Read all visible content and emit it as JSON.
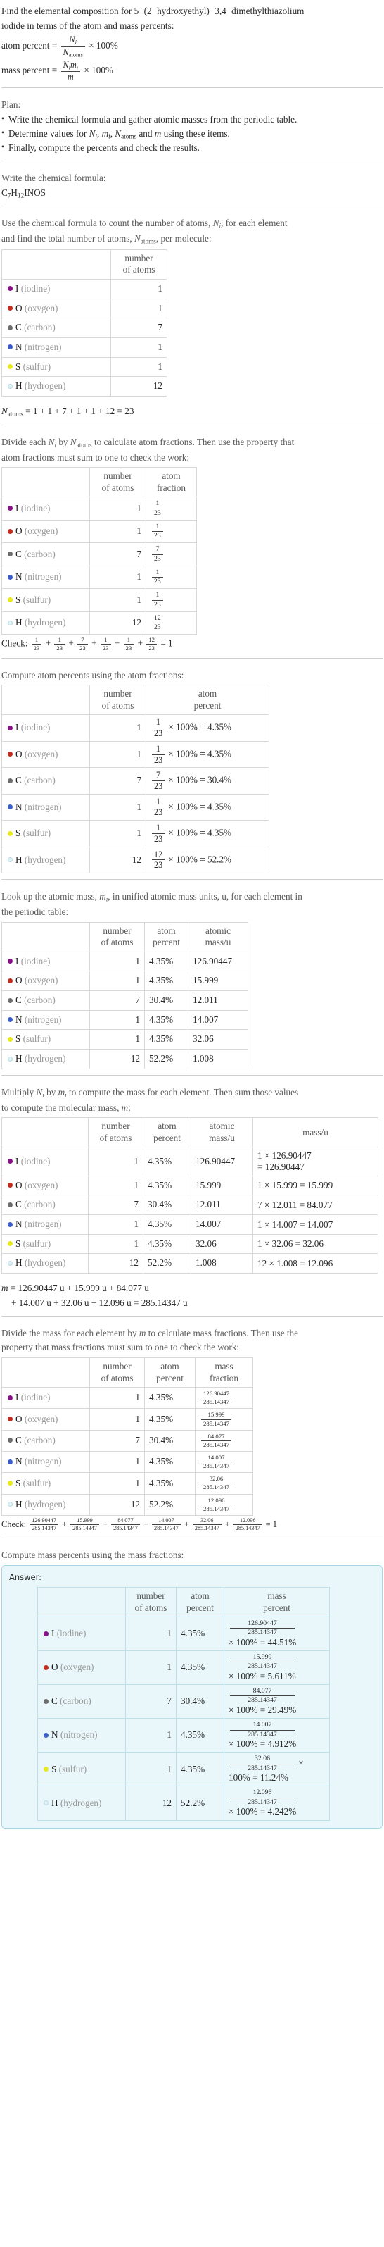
{
  "problem": {
    "statement_line1": "Find the elemental composition for 5−(2−hydroxyethyl)−3,4−dimethylthiazolium",
    "statement_line2": "iodide in terms of the atom and mass percents:",
    "atom_percent_label": "atom percent",
    "mass_percent_label": "mass percent",
    "times_100": "× 100%"
  },
  "plan": {
    "title": "Plan:",
    "items": [
      "Write the chemical formula and gather atomic masses from the periodic table.",
      "Determine values for Nᵢ, mᵢ, Nₐₜₒₘₛ and m using these items.",
      "Finally, compute the percents and check the results."
    ]
  },
  "formula_section": {
    "prompt": "Write the chemical formula:",
    "formula": "C7H12INOS",
    "formula_parts": [
      {
        "sym": "C",
        "sub": "7"
      },
      {
        "sym": "H",
        "sub": "12"
      },
      {
        "sym": "I",
        "sub": ""
      },
      {
        "sym": "N",
        "sub": ""
      },
      {
        "sym": "O",
        "sub": ""
      },
      {
        "sym": "S",
        "sub": ""
      }
    ]
  },
  "colors": {
    "iodine": "#8a0f8a",
    "oxygen": "#c32b1c",
    "carbon": "#6e6e6e",
    "nitrogen": "#3a5fcd",
    "sulfur": "#e8e81a",
    "hydrogen": "#dff2f7",
    "answer_bg": "#e9f7fb",
    "answer_border": "#a9d6e5"
  },
  "elements": [
    {
      "symbol": "I",
      "name": "(iodine)",
      "color": "#8a0f8a",
      "count": "1",
      "fraction_num": "1",
      "atom_percent": "4.35%",
      "atomic_mass": "126.90447",
      "mass_expr": "1 × 126.90447",
      "mass_expr_tail": "= 126.90447",
      "mass_value": "126.90447",
      "mass_percent": "44.51%"
    },
    {
      "symbol": "O",
      "name": "(oxygen)",
      "color": "#c32b1c",
      "count": "1",
      "fraction_num": "1",
      "atom_percent": "4.35%",
      "atomic_mass": "15.999",
      "mass_expr": "1 × 15.999 = 15.999",
      "mass_expr_tail": "",
      "mass_value": "15.999",
      "mass_percent": "5.611%"
    },
    {
      "symbol": "C",
      "name": "(carbon)",
      "color": "#6e6e6e",
      "count": "7",
      "fraction_num": "7",
      "atom_percent": "30.4%",
      "atomic_mass": "12.011",
      "mass_expr": "7 × 12.011 = 84.077",
      "mass_expr_tail": "",
      "mass_value": "84.077",
      "mass_percent": "29.49%"
    },
    {
      "symbol": "N",
      "name": "(nitrogen)",
      "color": "#3a5fcd",
      "count": "1",
      "fraction_num": "1",
      "atom_percent": "4.35%",
      "atomic_mass": "14.007",
      "mass_expr": "1 × 14.007 = 14.007",
      "mass_expr_tail": "",
      "mass_value": "14.007",
      "mass_percent": "4.912%"
    },
    {
      "symbol": "S",
      "name": "(sulfur)",
      "color": "#e8e81a",
      "count": "1",
      "fraction_num": "1",
      "atom_percent": "4.35%",
      "atomic_mass": "32.06",
      "mass_expr": "1 × 32.06 = 32.06",
      "mass_expr_tail": "",
      "mass_value": "32.06",
      "mass_percent": "11.24%"
    },
    {
      "symbol": "H",
      "name": "(hydrogen)",
      "color": "#dff2f7",
      "count": "12",
      "fraction_num": "12",
      "atom_percent": "52.2%",
      "atomic_mass": "1.008",
      "mass_expr": "12 × 1.008 = 12.096",
      "mass_expr_tail": "",
      "mass_value": "12.096",
      "mass_percent": "4.242%"
    }
  ],
  "headers": {
    "number_of_atoms_l1": "number",
    "number_of_atoms_l2": "of atoms",
    "atom_fraction_l1": "atom",
    "atom_fraction_l2": "fraction",
    "atom_percent_l1": "atom",
    "atom_percent_l2": "percent",
    "atomic_mass_l1": "atomic",
    "atomic_mass_l2": "mass/u",
    "mass_u": "mass/u",
    "mass_fraction_l1": "mass",
    "mass_fraction_l2": "fraction",
    "mass_percent_l1": "mass",
    "mass_percent_l2": "percent"
  },
  "count_section": {
    "line1": "Use the chemical formula to count the number of atoms, Nᵢ, for each element",
    "line2": "and find the total number of atoms, Nₐₜₒₘₛ, per molecule:",
    "total_label": "N",
    "total_sub": "atoms",
    "total_expr": "= 1 + 1 + 7 + 1 + 1 + 12 = 23",
    "total_value": "23",
    "denominator": "23"
  },
  "fraction_section": {
    "line1": "Divide each Nᵢ by Nₐₜₒₘₛ to calculate atom fractions. Then use the property that",
    "line2": "atom fractions must sum to one to check the work:",
    "check_label": "Check:",
    "check_result": "= 1"
  },
  "atom_percent_section": {
    "prompt": "Compute atom percents using the atom fractions:",
    "times": "× 100% ="
  },
  "atomic_mass_section": {
    "line1": "Look up the atomic mass, mᵢ, in unified atomic mass units, u, for each element in",
    "line2": "the periodic table:"
  },
  "multiply_section": {
    "line1": "Multiply Nᵢ by mᵢ to compute the mass for each element. Then sum those values",
    "line2": "to compute the molecular mass, m:",
    "m_equation_line1": "m = 126.90447 u + 15.999 u + 84.077 u",
    "m_equation_line2": "+ 14.007 u + 32.06 u + 12.096 u = 285.14347 u",
    "molecular_mass": "285.14347"
  },
  "mass_fraction_section": {
    "line1": "Divide the mass for each element by m to calculate mass fractions. Then use the",
    "line2": "property that mass fractions must sum to one to check the work:",
    "check_label": "Check:",
    "check_result": "= 1",
    "denominator": "285.14347"
  },
  "mass_percent_section": {
    "prompt": "Compute mass percents using the mass fractions:",
    "answer_label": "Answer:",
    "times": "× 100% =",
    "denominator": "285.14347"
  },
  "chart_data": {
    "type": "table",
    "title": "Elemental composition of C7H12INOS (5-(2-hydroxyethyl)-3,4-dimethylthiazolium iodide)",
    "categories": [
      "I (iodine)",
      "O (oxygen)",
      "C (carbon)",
      "N (nitrogen)",
      "S (sulfur)",
      "H (hydrogen)"
    ],
    "series": [
      {
        "name": "number of atoms",
        "values": [
          1,
          1,
          7,
          1,
          1,
          12
        ]
      },
      {
        "name": "atom percent",
        "values": [
          4.35,
          4.35,
          30.4,
          4.35,
          4.35,
          52.2
        ]
      },
      {
        "name": "atomic mass/u",
        "values": [
          126.90447,
          15.999,
          12.011,
          14.007,
          32.06,
          1.008
        ]
      },
      {
        "name": "mass/u",
        "values": [
          126.90447,
          15.999,
          84.077,
          14.007,
          32.06,
          12.096
        ]
      },
      {
        "name": "mass percent",
        "values": [
          44.51,
          5.611,
          29.49,
          4.912,
          11.24,
          4.242
        ]
      }
    ],
    "total_atoms": 23,
    "molecular_mass_u": 285.14347
  }
}
